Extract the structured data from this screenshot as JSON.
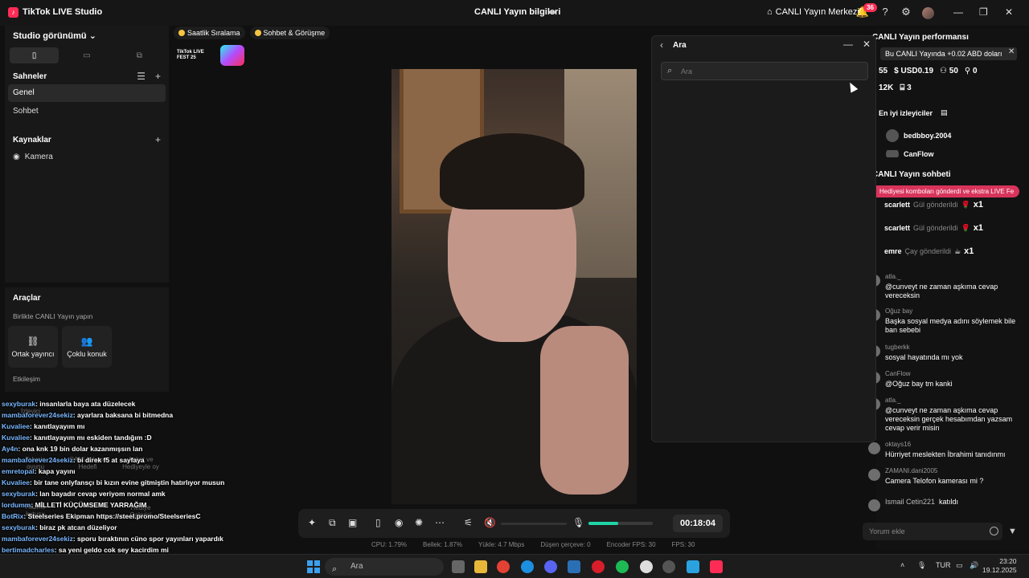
{
  "app": {
    "title": "TikTok LIVE Studio",
    "center_title": "CANLI Yayın bilgileri",
    "live_center": "CANLI Yayın Merkezi",
    "notif_count": "36"
  },
  "left": {
    "studio_view": "Studio görünümü",
    "scenes_label": "Sahneler",
    "scenes": [
      "Genel",
      "Sohbet"
    ],
    "sources_label": "Kaynaklar",
    "sources": [
      "Kamera"
    ],
    "tools_label": "Araçlar",
    "collab_label": "Birlikte CANLI Yayın yapın",
    "tools": [
      "Ortak yayıncı",
      "Çoklu konuk"
    ],
    "interaction_label": "Etkileşim"
  },
  "chips": [
    "Saatlik Sıralama",
    "Sohbet & Görüşme"
  ],
  "fest": "TikTok LIVE FEST 25",
  "controls": {
    "timer": "00:18:04",
    "mic_level": 0.46
  },
  "stats": [
    "CPU: 1.79%",
    "Bellek: 1.87%",
    "Yükle: 4.7 Mbps",
    "Düşen çerçeve: 0",
    "Encoder FPS: 30",
    "FPS: 30"
  ],
  "search": {
    "title": "Ara",
    "placeholder": "Ara"
  },
  "perf": {
    "title": "CANLI Yayın performansı",
    "banner": "Bu CANLI Yayında +0.02 ABD doları",
    "stats": [
      "55",
      "USD0.19",
      "50",
      "0"
    ],
    "stats2": [
      "12K",
      "3"
    ],
    "top_viewers": "En iyi izleyiciler",
    "viewers": [
      "bedbboy.2004",
      "CanFlow"
    ]
  },
  "chat_title": "CANLI Yayın sohbeti",
  "gift_banner": "Hediyesi komboları gönderdi ve ekstra LIVE Fe",
  "gifts": [
    {
      "user": "scarlett",
      "text": "Gül gönderildi",
      "count": "x1"
    },
    {
      "user": "scarlett",
      "text": "Gül gönderildi",
      "count": "x1"
    },
    {
      "user": "emre",
      "text": "Çay gönderildi",
      "count": "x1"
    }
  ],
  "chat": [
    {
      "user": "atla._",
      "msg": "@cunveyt ne zaman aşkıma cevap vereceksin"
    },
    {
      "user": "Oğuz bay",
      "msg": "Başka sosyal medya adını söylemek bile ban sebebi"
    },
    {
      "user": "tugberkk",
      "msg": "sosyal hayatında mı yok"
    },
    {
      "user": "CanFlow",
      "msg": "@Oğuz bay tm kanki"
    },
    {
      "user": "atla._",
      "msg": "@cunveyt ne zaman aşkıma cevap vereceksin gerçek hesabımdan yazsam cevap verir misin"
    },
    {
      "user": "oktays16",
      "msg": "Hürriyet meslekten İbrahimi tanıdınmı"
    },
    {
      "user": "ZAMANI.dani2005",
      "msg": "Camera Telofon kamerası mi ?"
    },
    {
      "user": "Ismail Cetin221",
      "msg": "katıldı"
    }
  ],
  "chat_input": "Yorum ekle",
  "overlay_chat": [
    {
      "user": "sexyburak",
      "msg": ": insanlarla baya ata düzelecek"
    },
    {
      "user": "mambaforever24sekiz",
      "msg": ": ayarlara baksana bi bitmedna"
    },
    {
      "user": "Kuvaliee",
      "msg": ": kanıtlayayım mı"
    },
    {
      "user": "Kuvaliee",
      "msg": ": kanıtlayayım mı eskiden tandığım :D"
    },
    {
      "user": "Ay4n",
      "msg": ": ona knk 19 bin dolar kazanmışsın lan"
    },
    {
      "user": "mambaforever24sekiz",
      "msg": ": bi direk f5 at sayfaya"
    },
    {
      "user": "emretopal",
      "msg": ": kapa yayını"
    },
    {
      "user": "Kuvaliee",
      "msg": ": bir tane onlyfansçı bi kızın evine gitmiştin hatırlıyor musun"
    },
    {
      "user": "sexyburak",
      "msg": ": lan bayadır cevap veriyom normal amk"
    },
    {
      "user": "lordumm",
      "msg": ": MİLLETİ KÜÇÜMSEME YARRAĞIM"
    },
    {
      "user": "BotRix",
      "msg": ": Steelseries Ekipman https://steel.promo/SteelseriesC"
    },
    {
      "user": "sexyburak",
      "msg": ": biraz pk atcan düzeliyor"
    },
    {
      "user": "mambaforever24sekiz",
      "msg": ": sporu bıraktının cüno spor yayınları yapardık"
    },
    {
      "user": "bertimadcharles",
      "msg": ": sa yeni geldo cok sey kacirdim mi"
    },
    {
      "user": "emretopal",
      "msg": ": saç yüzüne kanka evren hissetti"
    }
  ],
  "ghost_labels": [
    "İzleyici",
    "Tahmin oyunu",
    "CANLI Yayın Hedefi",
    "Anket ve Hediyeyle oy",
    "Hazine kutusu",
    "Hediye Galerisi"
  ],
  "taskbar": {
    "search": "Ara",
    "lang": "TUR",
    "time": "23:20",
    "date": "19.12.2025"
  }
}
